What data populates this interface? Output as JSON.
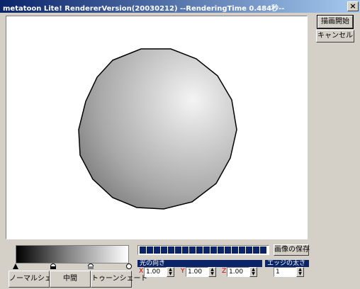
{
  "window": {
    "title": "metatoon Lite! RendererVersion(20030212) --RenderingTime 0.484秒--"
  },
  "buttons": {
    "render": "描画開始",
    "cancel": "キャンセル",
    "save_image": "画像の保存"
  },
  "shading": {
    "normal": "ノーマルシェード",
    "middle": "中間",
    "toon": "トゥーンシェード"
  },
  "progress": {
    "segments": 18,
    "fraction": 1.0
  },
  "light": {
    "label": "光の向き",
    "x_label": "X",
    "y_label": "Y",
    "z_label": "Z",
    "x": "1.00",
    "y": "1.00",
    "z": "1.00"
  },
  "edge": {
    "label": "エッジの太さ",
    "value": "1"
  },
  "colors": {
    "title_start": "#0a246a",
    "title_end": "#a6caf0",
    "progress": "#0a246a"
  }
}
